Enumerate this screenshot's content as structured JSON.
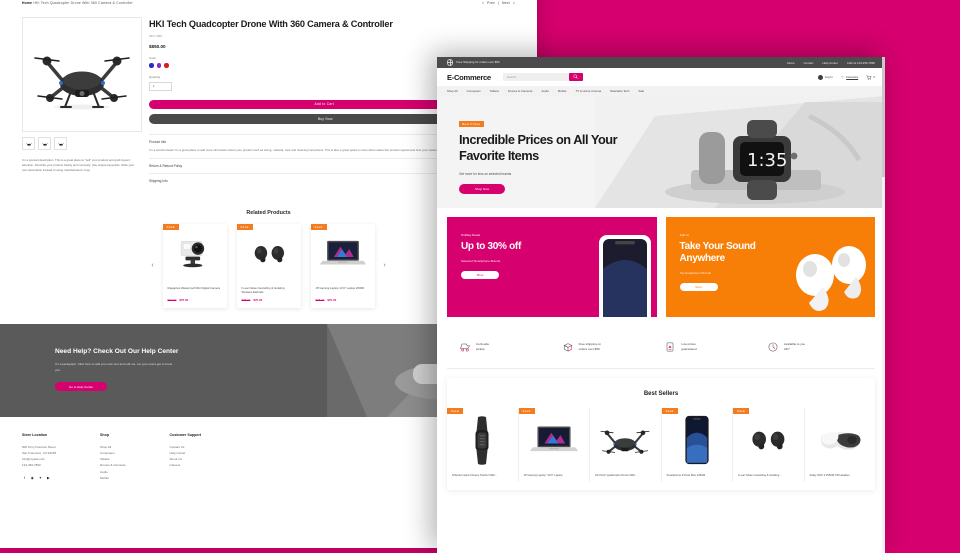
{
  "product_page": {
    "breadcrumb": {
      "home": "Home",
      "current": "HKI Tech Quadcopter Drone With 360 Camera & Controller"
    },
    "pagination": {
      "prev": "Prev",
      "next": "Next"
    },
    "title": "HKI Tech Quadcopter Drone With 360 Camera & Controller",
    "sku": "SKU: 0007",
    "price": "$850.00",
    "color_label": "Color",
    "colors": [
      "#2b2bbf",
      "#8e2bbf",
      "#d61d1d"
    ],
    "quantity_label": "Quantity",
    "quantity_value": "1",
    "add_to_cart": "Add to Cart",
    "buy_now": "Buy Now",
    "description": "I'm a product description. This is a great place to \"sell\" your product and grab buyers' attention. Describe your product clearly and concisely. Use unique keywords. Write your own description instead of using manufacturers' copy.",
    "accordion": [
      {
        "head": "Product Info",
        "sign": "–",
        "body": "I'm a product detail. I'm a great place to add more information about your product such as sizing, material, care and cleaning instructions. This is also a great space to write what makes this product special and how your customers can benefit from this item."
      },
      {
        "head": "Return & Refund Policy",
        "sign": "+",
        "body": ""
      },
      {
        "head": "Shipping Info",
        "sign": "+",
        "body": ""
      }
    ],
    "related_title": "Related Products",
    "related": [
      {
        "badge": "SALE",
        "name": "Megapixel Waterproof Mini Digital Camera",
        "old": "$90.00",
        "new": "$75.00",
        "art": "camera"
      },
      {
        "badge": "SALE",
        "name": "In-ear Noise Cancelling & Isolating Wireless Earbuds",
        "old": "$88.00",
        "new": "$75.00",
        "art": "earbuds"
      },
      {
        "badge": "SALE",
        "name": "JP Gaming Laptop 13.6\" Laptop 2000D",
        "old": "$95.00",
        "new": "$70.00",
        "art": "laptop"
      }
    ],
    "help": {
      "heading": "Need Help? Check Out Our Help Center",
      "paragraph": "I'm a paragraph. Click here to add your own text and edit me. Let your users get to know you.",
      "button": "Go to Help Center"
    },
    "footer": {
      "columns": [
        {
          "head": "Store Location",
          "items": [
            "500 Terry Francois Street",
            "San Francisco, CA 94158",
            "info@mysite.com",
            "123-456-7890"
          ]
        },
        {
          "head": "Shop",
          "items": [
            "Shop All",
            "Computers",
            "Tablets",
            "Drones & Cameras",
            "Audio",
            "Mobile"
          ]
        },
        {
          "head": "Customer Support",
          "items": [
            "Contact Us",
            "Help Center",
            "About Us",
            "Careers"
          ]
        }
      ],
      "socials": [
        "f",
        "◉",
        "✦",
        "▶"
      ]
    }
  },
  "home_page": {
    "topbar": {
      "shipping_note": "Free Shipping for orders over $50",
      "links": [
        "About",
        "Contact",
        "Help Center",
        "Call Us 123-456-7890"
      ]
    },
    "header": {
      "logo": "E-Commerce",
      "search_placeholder": "Search...",
      "search_icon": "search-icon",
      "login": "Log In",
      "favorites": "Favorites",
      "cart_count": "0"
    },
    "nav": [
      "Shop All",
      "Computers",
      "Tablets",
      "Drones & Cameras",
      "Audio",
      "Mobile",
      "TV & Home Cinema",
      "Wearable Tech",
      "Sale"
    ],
    "hero": {
      "tag": "Best Prices",
      "heading": "Incredible Prices on All Your Favorite Items",
      "subtext": "Get more for less on selected brands",
      "button": "Shop Now"
    },
    "promos": [
      {
        "kicker": "Holiday Deals",
        "heading": "Up to 30% off",
        "sub": "Selected Smartphone Brands",
        "button": "Shop",
        "color": "#d6006e"
      },
      {
        "kicker": "Just In",
        "heading": "Take Your Sound Anywhere",
        "sub": "Top Headphone Brands",
        "button": "Shop",
        "color": "#f77f08"
      }
    ],
    "features": [
      {
        "icon": "curbside-pickup-icon",
        "line1": "Curb-side",
        "line2": "pickup"
      },
      {
        "icon": "free-shipping-icon",
        "line1": "Free shipping on",
        "line2": "orders over $50"
      },
      {
        "icon": "low-prices-icon",
        "line1": "Low prices",
        "line2": "guaranteed"
      },
      {
        "icon": "clock-icon",
        "line1": "Available to you",
        "line2": "24/7"
      }
    ],
    "best_sellers": {
      "title": "Best Sellers",
      "items": [
        {
          "badge": "SALE",
          "name": "Fitbook Inspire Fitness Tracker With...",
          "art": "tracker"
        },
        {
          "badge": "SALE",
          "name": "JP Gaming Laptop \"13.6\" Laptop",
          "art": "laptop"
        },
        {
          "badge": "",
          "name": "HKI Tech Quadcopter Drone With...",
          "art": "drone"
        },
        {
          "badge": "SALE",
          "name": "Smartphone Z Pixel Max 128GB",
          "art": "phone"
        },
        {
          "badge": "SALE",
          "name": "In-ear Noise Cancelling & Isolating...",
          "art": "earbuds"
        },
        {
          "badge": "",
          "name": "Safay GDX 2 256GB VR Headset",
          "art": "vr"
        }
      ]
    }
  }
}
